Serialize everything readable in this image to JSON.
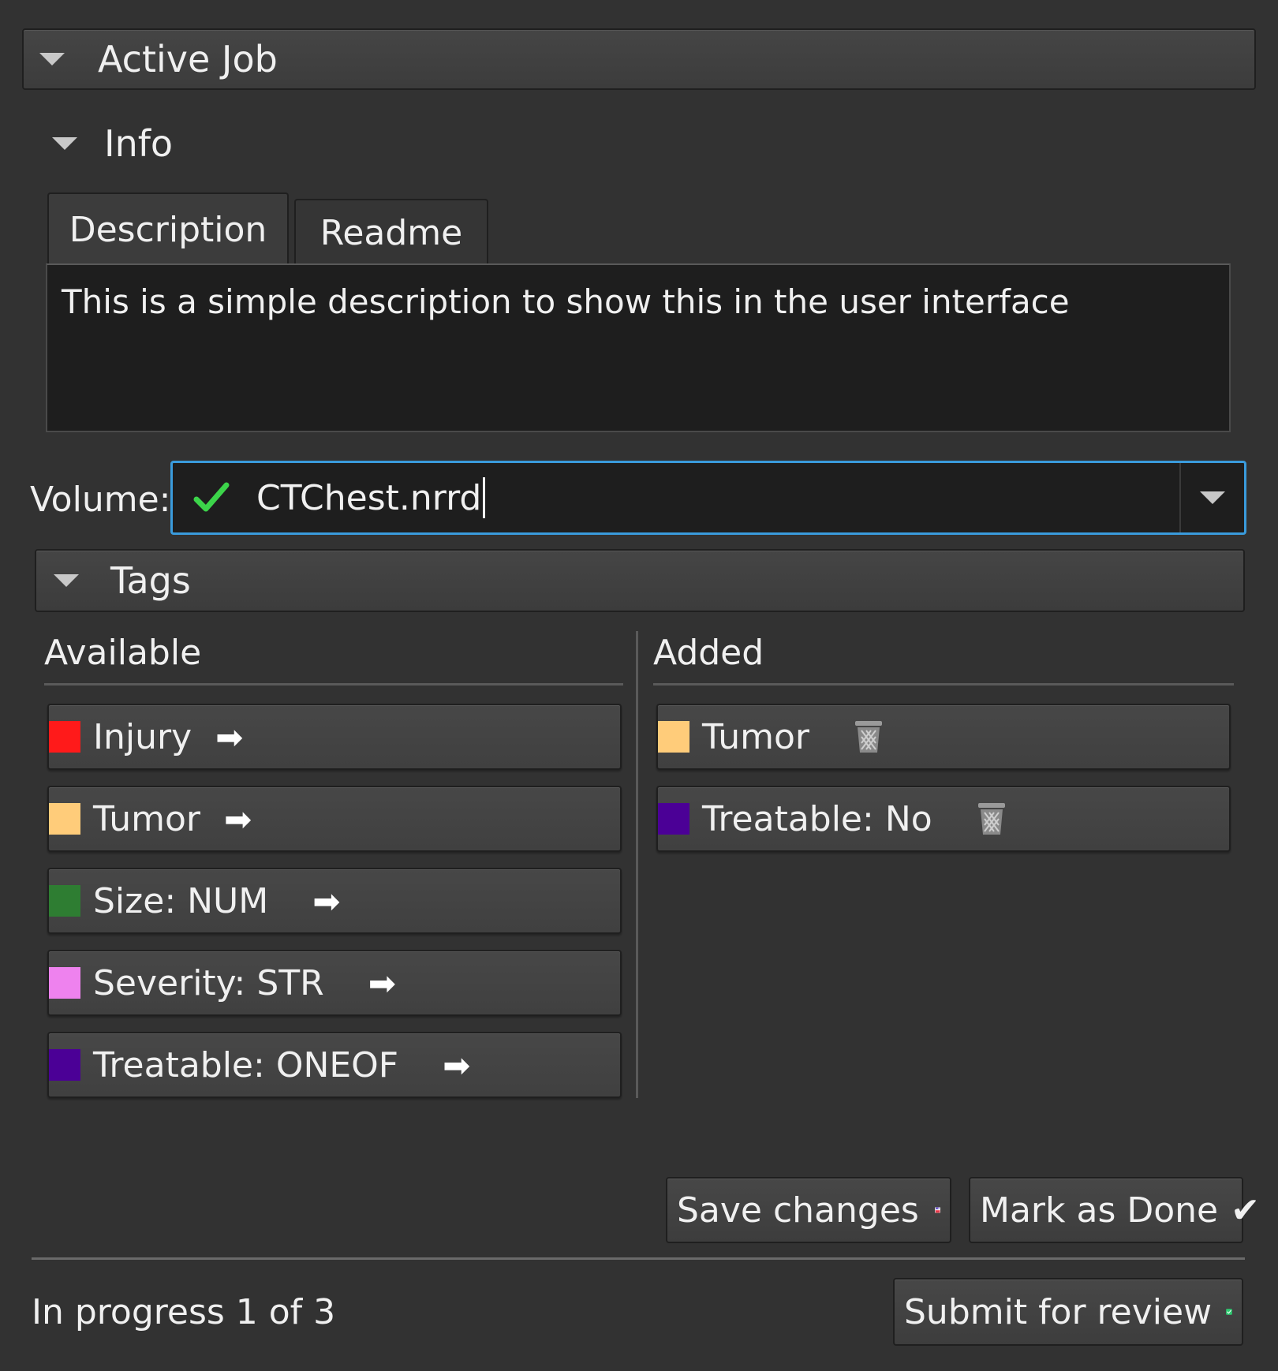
{
  "active_job": {
    "title": "Active Job"
  },
  "info": {
    "title": "Info",
    "tabs": [
      {
        "label": "Description",
        "active": true
      },
      {
        "label": "Readme",
        "active": false
      }
    ],
    "description_text": "This is a simple description to show this in the user interface"
  },
  "volume": {
    "label": "Volume:",
    "value": "CTChest.nrrd",
    "status_icon": "check-icon",
    "status_color": "#3cd44a",
    "accent": "#3a9bdc"
  },
  "tags": {
    "title": "Tags",
    "available_header": "Available",
    "added_header": "Added",
    "available": [
      {
        "label": "Injury",
        "color": "#ff1a1a",
        "icon": "right-arrow-icon"
      },
      {
        "label": "Tumor",
        "color": "#ffcc7a",
        "icon": "right-arrow-icon"
      },
      {
        "label": "Size: NUM",
        "color": "#2e7d32",
        "icon": "right-arrow-icon"
      },
      {
        "label": "Severity: STR",
        "color": "#ee82ee",
        "icon": "right-arrow-icon"
      },
      {
        "label": "Treatable: ONEOF",
        "color": "#4b0096",
        "icon": "right-arrow-icon"
      }
    ],
    "added": [
      {
        "label": "Tumor",
        "color": "#ffcc7a",
        "icon": "trash-icon"
      },
      {
        "label": "Treatable: No",
        "color": "#4b0096",
        "icon": "trash-icon"
      }
    ]
  },
  "actions": {
    "save_label": "Save changes",
    "save_icon": "floppy-disk-icon",
    "done_label": "Mark as Done",
    "done_icon": "checkmark-icon"
  },
  "footer": {
    "status": "In progress 1 of 3",
    "submit_label": "Submit for review",
    "submit_icon": "green-check-box-icon"
  }
}
